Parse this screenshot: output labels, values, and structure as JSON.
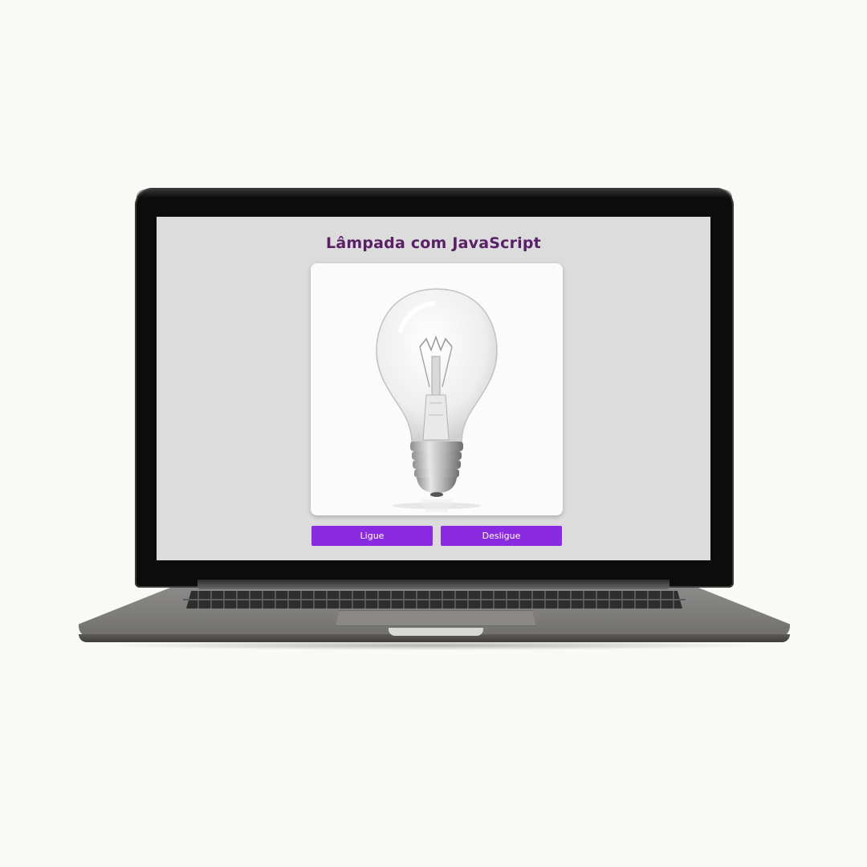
{
  "page": {
    "title": "Lâmpada com JavaScript"
  },
  "bulb": {
    "state": "off",
    "icon": "lightbulb-icon"
  },
  "buttons": {
    "on_label": "Ligue",
    "off_label": "Desligue"
  },
  "colors": {
    "title": "#5a1f67",
    "button": "#8a2be2",
    "screen_background": "#dcdcdc",
    "card_background": "#fbfbfb"
  }
}
